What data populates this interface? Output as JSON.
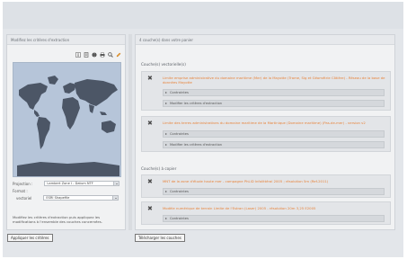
{
  "left_panel": {
    "title": "Modifiez les critères d'extraction",
    "projection_label": "Projection :",
    "projection_value": "Lambert Zone I - Datum NTF",
    "format_label": "Format :",
    "format_sub_label": "vectoriel",
    "format_value": "ESRI Shapefile",
    "note": "Modifiez les critères d'extraction puis appliquez les modifications à l'ensemble des couches concernées.",
    "apply_button": "Appliquer les critères"
  },
  "map_tools": [
    "info-icon",
    "layers-icon",
    "globe-icon",
    "print-icon",
    "zoom-icon",
    "pencil-icon"
  ],
  "right_panel": {
    "title": "4 couche(s) dans votre panier",
    "vector_section": "Couche(s) vectorielle(s)",
    "raster_section": "Couche(s) à copier",
    "download_button": "Télécharger les couches",
    "groups": [
      {
        "title": "Limite emprise administrative du domaine maritime (Mer) de la Mayotte (Trame, Sig et Géométrie Côtière) - Réseau de la base de données Mayotte",
        "subs": [
          "Contraintes",
          "Modifier les critères d'extraction"
        ]
      },
      {
        "title": "Limite des terres administratives du domaine maritime de la Martinique (Domaine maritime) (Pas-de-mer) - version v2",
        "subs": [
          "Contraintes",
          "Modifier les critères d'extraction"
        ]
      },
      {
        "title": "MNT de la zone d'étude haute mer - campagne PhLiD Infolittéral 2005 ; résolution 5m (Ref-2011)",
        "subs": [
          "Contraintes"
        ]
      },
      {
        "title": "Modèle numérique de terrain Limite de l'Estran (Laser) 2005 - résolution 20m 3,25 E2005",
        "subs": [
          "Contraintes"
        ]
      }
    ]
  },
  "colors": {
    "accent_orange": "#e8833a",
    "background": "#e3e6ea",
    "map_sea": "#b6c5d9",
    "map_land": "#4c5666"
  }
}
